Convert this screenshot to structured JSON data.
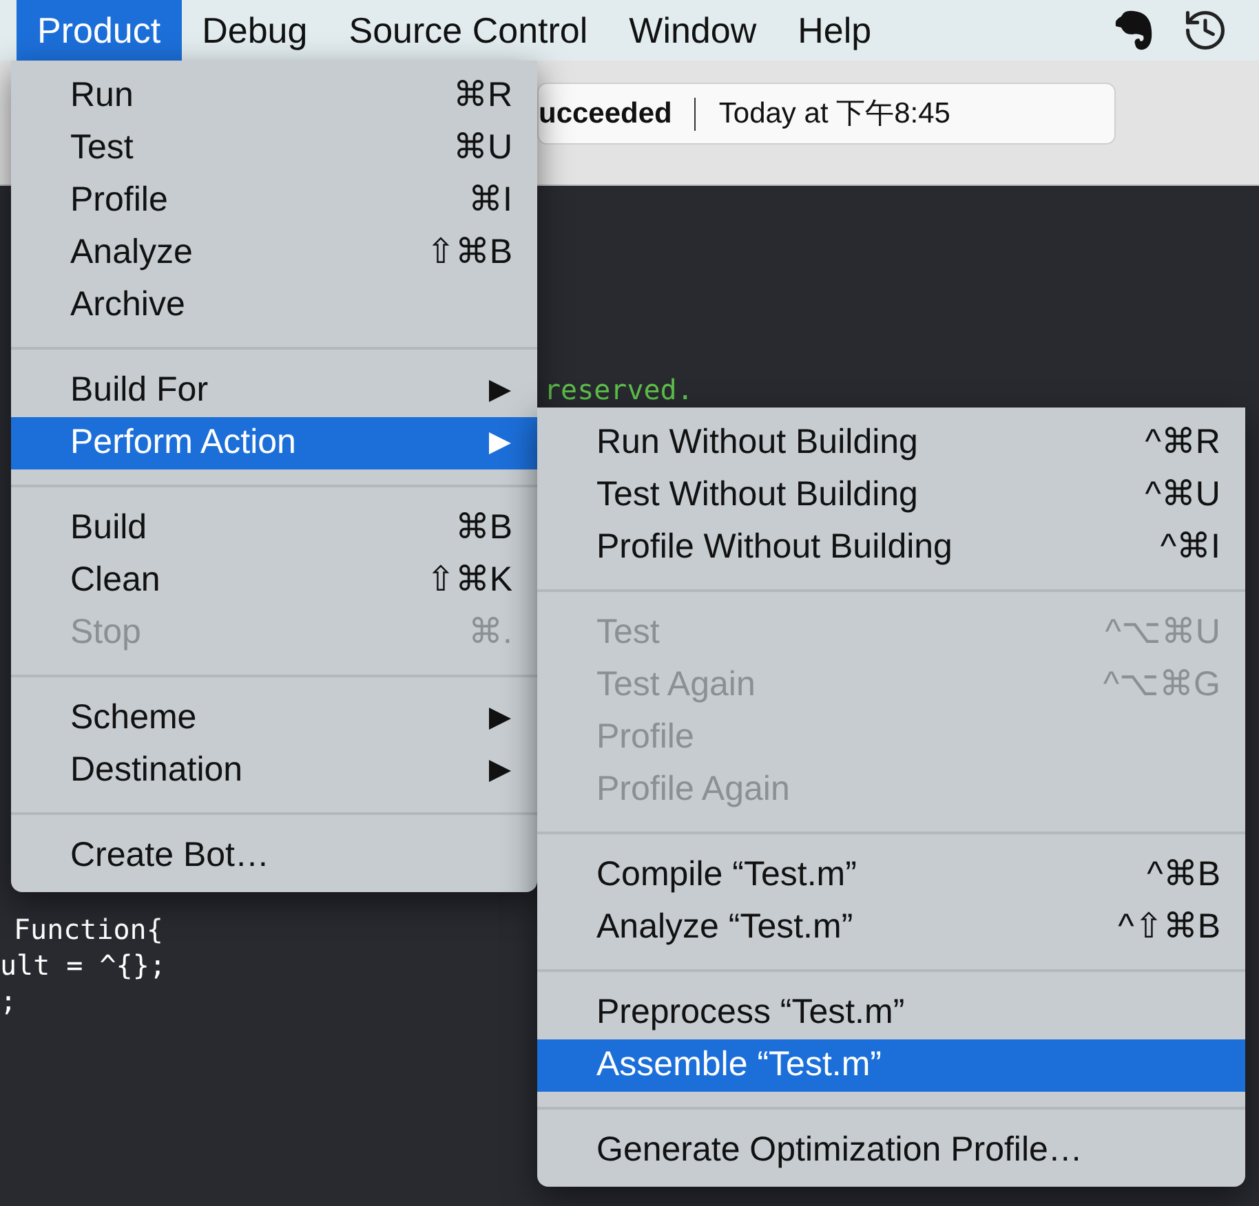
{
  "menu_bar": [
    {
      "label": "Product",
      "selected": true
    },
    {
      "label": "Debug",
      "selected": false
    },
    {
      "label": "Source Control",
      "selected": false
    },
    {
      "label": "Window",
      "selected": false
    },
    {
      "label": "Help",
      "selected": false
    }
  ],
  "activity": {
    "status": "ucceeded",
    "time": "Today at 下午8:45"
  },
  "editor_lines": [
    {
      "text": "reserved.",
      "kind": "comment"
    },
    {
      "text": "Function{",
      "kind": "code"
    },
    {
      "text": "ult = ^{};",
      "kind": "code"
    },
    {
      "text": ";",
      "kind": "code"
    }
  ],
  "product_menu": [
    [
      {
        "label": "Run",
        "shortcut": "⌘R",
        "disabled": false,
        "selected": false,
        "submenu": false
      },
      {
        "label": "Test",
        "shortcut": "⌘U",
        "disabled": false,
        "selected": false,
        "submenu": false
      },
      {
        "label": "Profile",
        "shortcut": "⌘I",
        "disabled": false,
        "selected": false,
        "submenu": false
      },
      {
        "label": "Analyze",
        "shortcut": "⇧⌘B",
        "disabled": false,
        "selected": false,
        "submenu": false
      },
      {
        "label": "Archive",
        "disabled": false,
        "selected": false,
        "submenu": false
      }
    ],
    [
      {
        "label": "Build For",
        "disabled": false,
        "selected": false,
        "submenu": true
      },
      {
        "label": "Perform Action",
        "disabled": false,
        "selected": true,
        "submenu": true
      }
    ],
    [
      {
        "label": "Build",
        "shortcut": "⌘B",
        "disabled": false,
        "selected": false,
        "submenu": false
      },
      {
        "label": "Clean",
        "shortcut": "⇧⌘K",
        "disabled": false,
        "selected": false,
        "submenu": false
      },
      {
        "label": "Stop",
        "shortcut": "⌘.",
        "disabled": true,
        "selected": false,
        "submenu": false
      }
    ],
    [
      {
        "label": "Scheme",
        "disabled": false,
        "selected": false,
        "submenu": true
      },
      {
        "label": "Destination",
        "disabled": false,
        "selected": false,
        "submenu": true
      }
    ],
    [
      {
        "label": "Create Bot…",
        "disabled": false,
        "selected": false,
        "submenu": false
      }
    ]
  ],
  "perform_action_menu": [
    [
      {
        "label": "Run Without Building",
        "shortcut": "^⌘R",
        "disabled": false,
        "selected": false
      },
      {
        "label": "Test Without Building",
        "shortcut": "^⌘U",
        "disabled": false,
        "selected": false
      },
      {
        "label": "Profile Without Building",
        "shortcut": "^⌘I",
        "disabled": false,
        "selected": false
      }
    ],
    [
      {
        "label": "Test",
        "shortcut": "^⌥⌘U",
        "disabled": true,
        "selected": false
      },
      {
        "label": "Test Again",
        "shortcut": "^⌥⌘G",
        "disabled": true,
        "selected": false
      },
      {
        "label": "Profile",
        "disabled": true,
        "selected": false
      },
      {
        "label": "Profile Again",
        "disabled": true,
        "selected": false
      }
    ],
    [
      {
        "label": "Compile “Test.m”",
        "shortcut": "^⌘B",
        "disabled": false,
        "selected": false
      },
      {
        "label": "Analyze “Test.m”",
        "shortcut": "^⇧⌘B",
        "disabled": false,
        "selected": false
      }
    ],
    [
      {
        "label": "Preprocess “Test.m”",
        "disabled": false,
        "selected": false
      },
      {
        "label": "Assemble “Test.m”",
        "disabled": false,
        "selected": true
      }
    ],
    [
      {
        "label": "Generate Optimization Profile…",
        "disabled": false,
        "selected": false
      }
    ]
  ]
}
